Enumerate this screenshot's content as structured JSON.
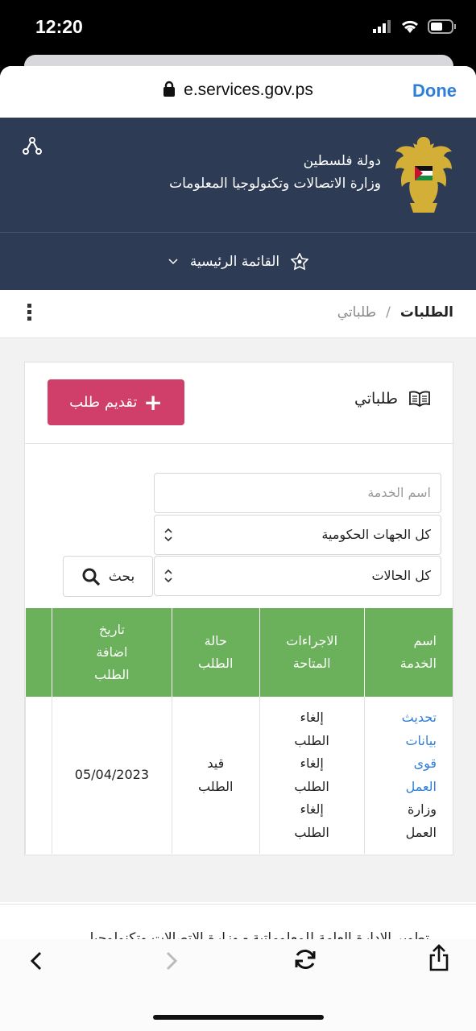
{
  "status_bar": {
    "time": "12:20"
  },
  "browser": {
    "url": "e.services.gov.ps",
    "done_label": "Done"
  },
  "header": {
    "gov_name": "دولة فلسطين",
    "ministry_name": "وزارة الاتصالات وتكنولوجيا المعلومات",
    "menu_label": "القائمة الرئيسية"
  },
  "breadcrumb": {
    "current": "الطلبات",
    "separator": "/",
    "link": "طلباتي"
  },
  "card": {
    "title": "طلباتي",
    "add_button": "تقديم طلب",
    "search_placeholder": "اسم الخدمة",
    "gov_select": "كل الجهات الحكومية",
    "status_select": "كل الحالات",
    "search_button": "بحث"
  },
  "table": {
    "headers": {
      "service": [
        "اسم",
        "الخدمة"
      ],
      "actions": [
        "الاجراءات",
        "المتاحة"
      ],
      "status": [
        "حالة",
        "الطلب"
      ],
      "date": [
        "تاريخ",
        "اضافة",
        "الطلب"
      ]
    },
    "row": {
      "service_link": [
        "تحديث",
        "بيانات",
        "قوى",
        "العمل"
      ],
      "service_org": [
        "وزارة",
        "العمل"
      ],
      "actions": [
        "إلغاء",
        "الطلب",
        "إلغاء",
        "الطلب",
        "إلغاء",
        "الطلب"
      ],
      "status": [
        "قيد",
        "الطلب"
      ],
      "date": "05/04/2023"
    }
  },
  "footer": {
    "text": "تطوير الادارة العامة للمعلوماتية - وزارة الاتصالات وتكنولوجيا"
  },
  "colors": {
    "header": "#2d3b55",
    "accent": "#cf3f69",
    "table_head": "#6bb15b",
    "link": "#2f7fd9"
  }
}
